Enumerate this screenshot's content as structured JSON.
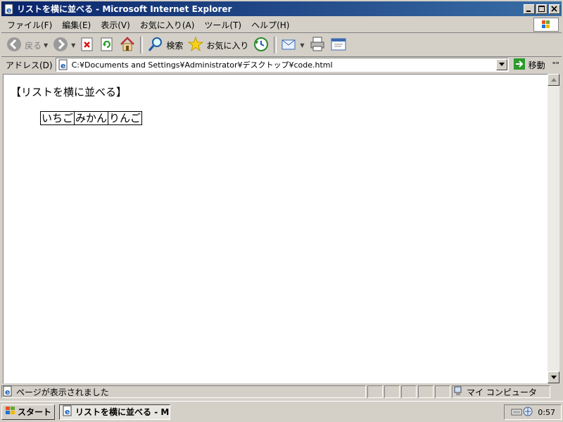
{
  "window": {
    "title": "リストを横に並べる - Microsoft Internet Explorer"
  },
  "menu": {
    "items": [
      "ファイル(F)",
      "編集(E)",
      "表示(V)",
      "お気に入り(A)",
      "ツール(T)",
      "ヘルプ(H)"
    ]
  },
  "toolbar": {
    "back_label": "戻る",
    "search_label": "検索",
    "favorites_label": "お気に入り"
  },
  "address": {
    "label": "アドレス(D)",
    "value": "C:¥Documents and Settings¥Administrator¥デスクトップ¥code.html",
    "go_label": "移動",
    "links_label": "\"\""
  },
  "page": {
    "heading": "【リストを横に並べる】",
    "list_items": [
      "いちご",
      "みかん",
      "りんご"
    ]
  },
  "status": {
    "text": "ページが表示されました",
    "zone": "マイ コンピュータ"
  },
  "taskbar": {
    "start_label": "スタート",
    "task_label": "リストを横に並べる - M...",
    "clock": "0:57"
  },
  "colors": {
    "titlebar_start": "#0a246a",
    "titlebar_end": "#3a6ea5",
    "chrome": "#d4d0c8"
  }
}
